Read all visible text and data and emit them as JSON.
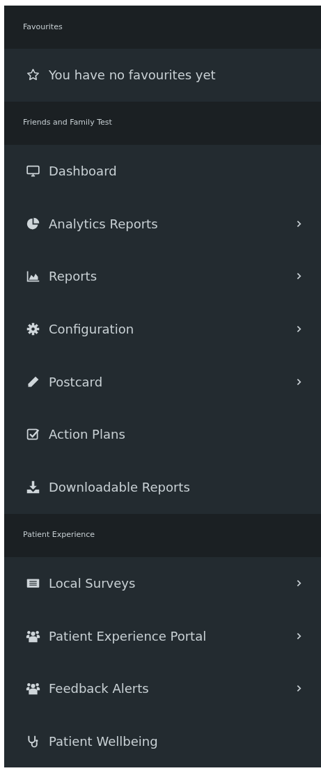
{
  "sidebar": {
    "sections": [
      {
        "title": "Favourites",
        "items": [
          {
            "label": "You have no favourites yet",
            "submenu": false
          }
        ]
      },
      {
        "title": "Friends and Family Test",
        "items": [
          {
            "label": "Dashboard",
            "submenu": false
          },
          {
            "label": "Analytics Reports",
            "submenu": true
          },
          {
            "label": "Reports",
            "submenu": true
          },
          {
            "label": "Configuration",
            "submenu": true
          },
          {
            "label": "Postcard",
            "submenu": true
          },
          {
            "label": "Action Plans",
            "submenu": false
          },
          {
            "label": "Downloadable Reports",
            "submenu": false
          }
        ]
      },
      {
        "title": "Patient Experience",
        "items": [
          {
            "label": "Local Surveys",
            "submenu": true
          },
          {
            "label": "Patient Experience Portal",
            "submenu": true
          },
          {
            "label": "Feedback Alerts",
            "submenu": true
          },
          {
            "label": "Patient Wellbeing",
            "submenu": false
          }
        ]
      }
    ]
  }
}
